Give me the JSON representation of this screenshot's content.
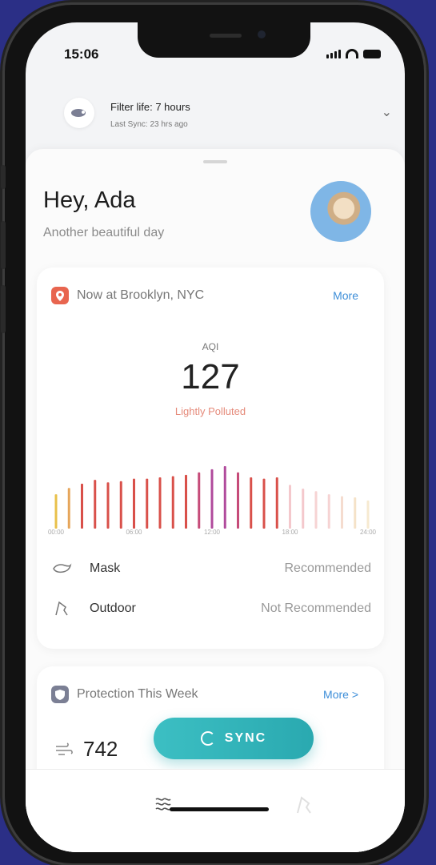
{
  "status": {
    "time": "15:06"
  },
  "filter": {
    "title": "Filter life: 7 hours",
    "subtitle": "Last Sync: 23 hrs ago"
  },
  "greeting": {
    "title": "Hey, Ada",
    "subtitle": "Another beautiful day"
  },
  "now_card": {
    "location": "Now at Brooklyn, NYC",
    "more": "More",
    "aqi_label": "AQI",
    "aqi_value": "127",
    "aqi_status": "Lightly Polluted",
    "time_ticks": [
      "00:00",
      "06:00",
      "12:00",
      "18:00",
      "24:00"
    ],
    "hourly_level": [
      0.55,
      0.65,
      0.72,
      0.78,
      0.74,
      0.76,
      0.8,
      0.8,
      0.82,
      0.84,
      0.86,
      0.9,
      0.95,
      1.0,
      0.9,
      0.82,
      0.8,
      0.82,
      0.7,
      0.64,
      0.6,
      0.55,
      0.52,
      0.5,
      0.45
    ],
    "hourly_colors": [
      "#e9c04a",
      "#e6a55a",
      "#d9504a",
      "#d9504a",
      "#d9504a",
      "#d9504a",
      "#d9504a",
      "#d9504a",
      "#d9504a",
      "#d9504a",
      "#d9504a",
      "#c64b79",
      "#b04a9c",
      "#b04a9c",
      "#c64b79",
      "#d9504a",
      "#d9504a",
      "#d9504a",
      "#f4c8cc",
      "#f4c8cc",
      "#f6d3d3",
      "#f6d3d3",
      "#f5dccf",
      "#f5e2c8",
      "#f6ead0"
    ],
    "recommendations": [
      {
        "label": "Mask",
        "value": "Recommended"
      },
      {
        "label": "Outdoor",
        "value": "Not Recommended"
      }
    ]
  },
  "protection_card": {
    "title": "Protection This Week",
    "more": "More >",
    "count": "742"
  },
  "sync_button": "SYNC",
  "colors": {
    "accent": "#2aa9b0",
    "location_badge": "#e8654f",
    "link": "#3d8ed8",
    "warning_text": "#e58a7a"
  }
}
